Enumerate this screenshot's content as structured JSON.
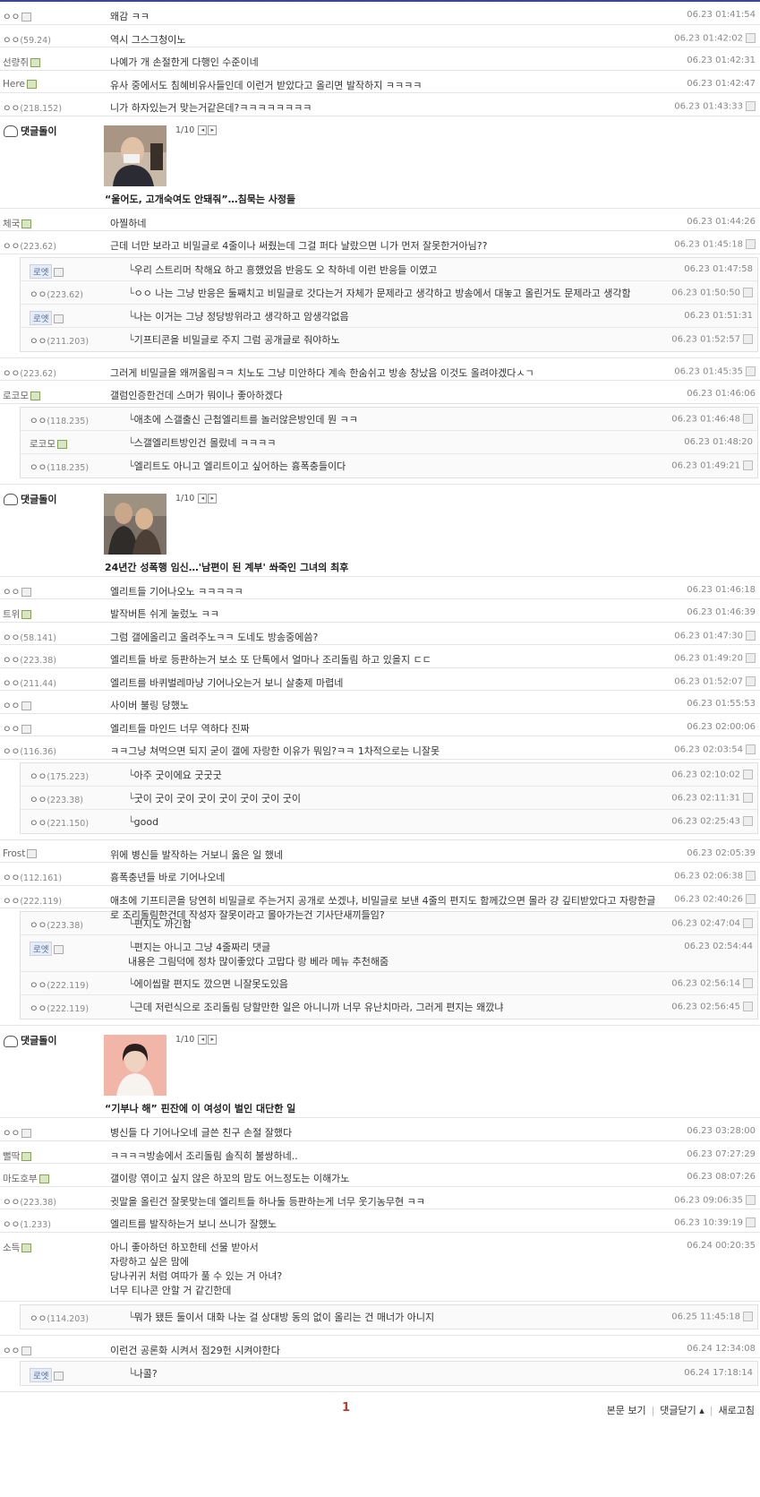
{
  "comments_1": [
    {
      "nick": "ㅇㅇ",
      "ip": "",
      "icon": "fixed",
      "text": "왜감 ㅋㅋ",
      "date": "06.23 01:41:54"
    },
    {
      "nick": "ㅇㅇ",
      "ip": "(59.24)",
      "icon": "",
      "text": "역시 그스그청이노",
      "date": "06.23 01:42:02"
    },
    {
      "nick": "선량쥐",
      "ip": "",
      "icon": "green",
      "text": "나예가 개 손절한게 다행인 수준이네",
      "date": "06.23 01:42:31"
    },
    {
      "nick": "Here",
      "ip": "",
      "icon": "green",
      "text": "유사 중에서도 침혜비유사들인데 이런거 받았다고 올리면 발작하지 ㅋㅋㅋㅋ",
      "date": "06.23 01:42:47"
    },
    {
      "nick": "ㅇㅇ",
      "ip": "(218.152)",
      "icon": "",
      "text": "니가 하자있는거 맞는거같은데?ㅋㅋㅋㅋㅋㅋㅋㅋ",
      "date": "06.23 01:43:33"
    }
  ],
  "ad1": {
    "owner": "댓글돌이",
    "pager": "1/10",
    "title": "“울어도, 고개숙여도 안돼줘”…침묵는 사정들"
  },
  "comments_2": [
    {
      "nick": "체국",
      "ip": "",
      "icon": "green",
      "text": "아찔하네",
      "date": "06.23 01:44:26"
    },
    {
      "nick": "ㅇㅇ",
      "ip": "(223.62)",
      "icon": "",
      "text": "근데 너만 보라고 비밀글로 4줄이나 써줬는데 그걸 퍼다 날랐으면 니가 먼저 잘못한거아님??",
      "date": "06.23 01:45:18"
    }
  ],
  "replies_2": [
    {
      "nick": "로엣",
      "ip": "",
      "tag": true,
      "icon": "fixed",
      "text": "우리 스트리머 착해요 하고 흥했었음 반응도 오 착하네 이런 반응들 이였고",
      "date": "06.23 01:47:58"
    },
    {
      "nick": "ㅇㅇ",
      "ip": "(223.62)",
      "tag": false,
      "icon": "",
      "text": "ㅇㅇ 나는 그냥 반응은 둘째치고 비밀글로 갓다는거 자체가 문제라고 생각하고 방송에서 대놓고 올린거도 문제라고 생각함",
      "date": "06.23 01:50:50"
    },
    {
      "nick": "로엣",
      "ip": "",
      "tag": true,
      "icon": "fixed",
      "text": "나는 이거는 그냥 정당방위라고 생각하고 암생각없음",
      "date": "06.23 01:51:31"
    },
    {
      "nick": "ㅇㅇ",
      "ip": "(211.203)",
      "tag": false,
      "icon": "",
      "text": "기프티콘을 비밀글로 주지 그럼 공개글로 줘야하노",
      "date": "06.23 01:52:57"
    }
  ],
  "comments_3": [
    {
      "nick": "ㅇㅇ",
      "ip": "(223.62)",
      "icon": "",
      "text": "그러게 비밀글을 왜꺼올림ㅋㅋ 치노도 그냥 미안하다 계속 한숨쉬고 방송 창났음 이것도 올려야겠다ㅅㄱ",
      "date": "06.23 01:45:35"
    },
    {
      "nick": "로코모",
      "ip": "",
      "icon": "green",
      "text": "갤럼인증한건데 스머가 뭐이나 좋아하겠다",
      "date": "06.23 01:46:06"
    }
  ],
  "replies_3": [
    {
      "nick": "ㅇㅇ",
      "ip": "(118.235)",
      "tag": false,
      "icon": "",
      "text": "애초에 스갤출신 근첩엘리트를 놀러않은방인데 뭔 ㅋㅋ",
      "date": "06.23 01:46:48"
    },
    {
      "nick": "로코모",
      "ip": "",
      "tag": false,
      "icon": "green",
      "text": "스갤엘리트방인건 몰랐네 ㅋㅋㅋㅋ",
      "date": "06.23 01:48:20"
    },
    {
      "nick": "ㅇㅇ",
      "ip": "(118.235)",
      "tag": false,
      "icon": "",
      "text": "엘리트도 아니고 엘리트이고 싶어하는 흉폭충들이다",
      "date": "06.23 01:49:21"
    }
  ],
  "ad2": {
    "owner": "댓글돌이",
    "pager": "1/10",
    "title": "24년간 성폭행 임신…'남편이 된 계부' 쏴죽인 그녀의 최후"
  },
  "comments_4": [
    {
      "nick": "ㅇㅇ",
      "ip": "",
      "icon": "fixed",
      "text": "엘리트들 기어나오노 ㅋㅋㅋㅋㅋ",
      "date": "06.23 01:46:18"
    },
    {
      "nick": "트위",
      "ip": "",
      "icon": "green",
      "text": "발작버튼 쉬게 눌렀노 ㅋㅋ",
      "date": "06.23 01:46:39"
    },
    {
      "nick": "ㅇㅇ",
      "ip": "(58.141)",
      "icon": "",
      "text": "그럼 갤에올리고 올려주노ㅋㅋ 도네도 방송중에씀?",
      "date": "06.23 01:47:30"
    },
    {
      "nick": "ㅇㅇ",
      "ip": "(223.38)",
      "icon": "",
      "text": "엘리트들 바로 등판하는거 보소 또 단톡에서 얼마나 조리돌림 하고 있을지 ㄷㄷ",
      "date": "06.23 01:49:20"
    },
    {
      "nick": "ㅇㅇ",
      "ip": "(211.44)",
      "icon": "",
      "text": "엘리트를 바퀴벌레마냥 기어나오는거 보니 살충제 마렵네",
      "date": "06.23 01:52:07"
    },
    {
      "nick": "ㅇㅇ",
      "ip": "",
      "icon": "fixed",
      "text": "사이버 불링 당했노",
      "date": "06.23 01:55:53"
    },
    {
      "nick": "ㅇㅇ",
      "ip": "",
      "icon": "fixed",
      "text": "엘리트들 마인드 너무 역하다 진짜",
      "date": "06.23 02:00:06"
    },
    {
      "nick": "ㅇㅇ",
      "ip": "(116.36)",
      "icon": "",
      "text": "ㅋㅋ그냥 쳐먹으면 되지 굳이 갤에 자랑한 이유가 뭐임?ㅋㅋ 1차적으로는 니잘못",
      "date": "06.23 02:03:54"
    }
  ],
  "replies_4": [
    {
      "nick": "ㅇㅇ",
      "ip": "(175.223)",
      "tag": false,
      "icon": "",
      "text": "아주 굿이에요 굿굿굿",
      "date": "06.23 02:10:02"
    },
    {
      "nick": "ㅇㅇ",
      "ip": "(223.38)",
      "tag": false,
      "icon": "",
      "text": "굿이 굿이 굿이 굿이 굿이 굿이 굿이 굿이",
      "date": "06.23 02:11:31"
    },
    {
      "nick": "ㅇㅇ",
      "ip": "(221.150)",
      "tag": false,
      "icon": "",
      "text": "good",
      "date": "06.23 02:25:43"
    }
  ],
  "comments_5": [
    {
      "nick": "Frost",
      "ip": "",
      "icon": "fixed",
      "text": "위에 병신들 발작하는 거보니 옳은 일 했네",
      "date": "06.23 02:05:39"
    },
    {
      "nick": "ㅇㅇ",
      "ip": "(112.161)",
      "icon": "",
      "text": "흉폭충년들 바로 기어나오네",
      "date": "06.23 02:06:38"
    },
    {
      "nick": "ㅇㅇ",
      "ip": "(222.119)",
      "icon": "",
      "text": "애초에 기프티콘을 당연히 비밀글로 주는거지 공개로 쏘겠냐, 비밀글로 보낸 4줄의 편지도 함께갔으면 몰라 걍 깊티받았다고 자랑한글로 조리돌림한건데 작성자 잘못이라고 몰아가는건 기사단새끼들임?",
      "date": "06.23 02:40:26"
    }
  ],
  "replies_5": [
    {
      "nick": "ㅇㅇ",
      "ip": "(223.38)",
      "tag": false,
      "icon": "",
      "text": "편지도 까긴함",
      "date": "06.23 02:47:04"
    },
    {
      "nick": "로엣",
      "ip": "",
      "tag": true,
      "icon": "fixed",
      "text": "편지는 아니고 그냥 4줄짜리 댓글\n내용은 그림덕에 정차 많이좋았다 고맙다 랑 베라 메뉴 추천해줌",
      "date": "06.23 02:54:44"
    },
    {
      "nick": "ㅇㅇ",
      "ip": "(222.119)",
      "tag": false,
      "icon": "",
      "text": "에이씹랄 편지도 깠으면 니잘못도있음",
      "date": "06.23 02:56:14"
    },
    {
      "nick": "ㅇㅇ",
      "ip": "(222.119)",
      "tag": false,
      "icon": "",
      "text": "근데 저런식으로 조리돌림 당할만한 일은 아니니까 너무 유난치마라, 그러게 편지는 왜깠냐",
      "date": "06.23 02:56:45"
    }
  ],
  "ad3": {
    "owner": "댓글돌이",
    "pager": "1/10",
    "title": "“기부나 해” 핀잔에 이 여성이 벌인 대단한 일"
  },
  "comments_6": [
    {
      "nick": "ㅇㅇ",
      "ip": "",
      "icon": "fixed",
      "text": "병신들 다 기어나오네 글쓴 친구 손절 잘했다",
      "date": "06.23 03:28:00"
    },
    {
      "nick": "뻘딱",
      "ip": "",
      "icon": "green",
      "text": "ㅋㅋㅋㅋ방송에서 조리돌림 솔직히 불쌍하네..",
      "date": "06.23 07:27:29"
    },
    {
      "nick": "마도호부",
      "ip": "",
      "icon": "green",
      "text": "갤이랑 엮이고 싶지 않은 하꼬의 맘도 어느정도는 이해가노",
      "date": "06.23 08:07:26"
    },
    {
      "nick": "ㅇㅇ",
      "ip": "(223.38)",
      "icon": "",
      "text": "귓말을 올린건 잘못맞는데 엘리트들 하나둘 등판하는게 너무 웃기농무현 ㅋㅋ",
      "date": "06.23 09:06:35"
    },
    {
      "nick": "ㅇㅇ",
      "ip": "(1.233)",
      "icon": "",
      "text": "엘리트를 발작하는거 보니 쓰니가 잘했노",
      "date": "06.23 10:39:19"
    },
    {
      "nick": "소득",
      "ip": "",
      "icon": "green",
      "text": "아니 좋아하던 하꼬한테 선물 받아서\n자랑하고 싶은 맘에\n당나귀귀 처럼 여따가 풀 수 있는 거 아녀?\n너무 티나콘 안할 거 같긴한데",
      "date": "06.24 00:20:35"
    }
  ],
  "replies_6": [
    {
      "nick": "ㅇㅇ",
      "ip": "(114.203)",
      "tag": false,
      "icon": "",
      "text": "뭐가 됐든 둘이서 대화 나눈 걸 상대방 동의 없이 올리는 건 매너가 아니지",
      "date": "06.25 11:45:18"
    }
  ],
  "comments_7": [
    {
      "nick": "ㅇㅇ",
      "ip": "",
      "icon": "fixed",
      "text": "이런건 공론화 시켜서 점29헌 시켜야한다",
      "date": "06.24 12:34:08"
    }
  ],
  "replies_7": [
    {
      "nick": "로엣",
      "ip": "",
      "tag": true,
      "icon": "fixed",
      "text": "나콜?",
      "date": "06.24 17:18:14"
    }
  ],
  "footer": {
    "page": "1",
    "view_post": "본문 보기",
    "collapse": "댓글닫기 ▴",
    "refresh": "새로고침"
  }
}
